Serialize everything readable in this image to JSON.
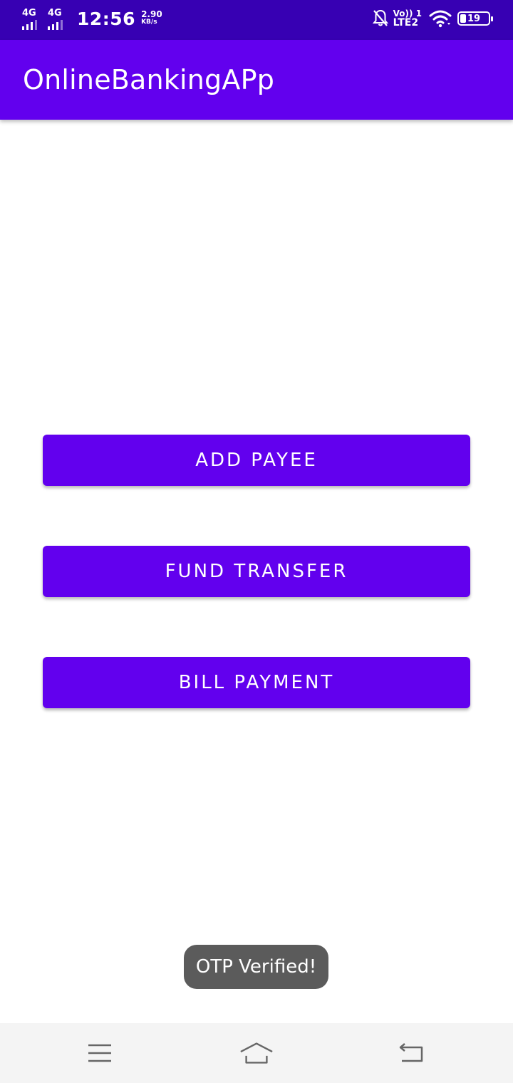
{
  "status_bar": {
    "network1": "4G",
    "network2": "4G",
    "time": "12:56",
    "speed_value": "2.90",
    "speed_unit": "KB/s",
    "volte_top": "Vo)) 1",
    "volte_bottom": "LTE2",
    "battery_level": "19",
    "battery_fill": 0.19,
    "icons": [
      "signal-icon",
      "notifications-off-icon",
      "wifi-icon",
      "battery-icon"
    ]
  },
  "app_bar": {
    "title": "OnlineBankingAPp"
  },
  "actions": {
    "add_payee": "ADD PAYEE",
    "fund_transfer": "FUND TRANSFER",
    "bill_payment": "BILL PAYMENT"
  },
  "toast": {
    "message": "OTP Verified!"
  },
  "nav_bar": {
    "icons": [
      "menu-icon",
      "home-icon",
      "back-icon"
    ]
  },
  "colors": {
    "status_bar": "#3700b3",
    "primary": "#6200ee",
    "toast": "#5b5b5b",
    "nav_bar": "#f4f4f4"
  }
}
